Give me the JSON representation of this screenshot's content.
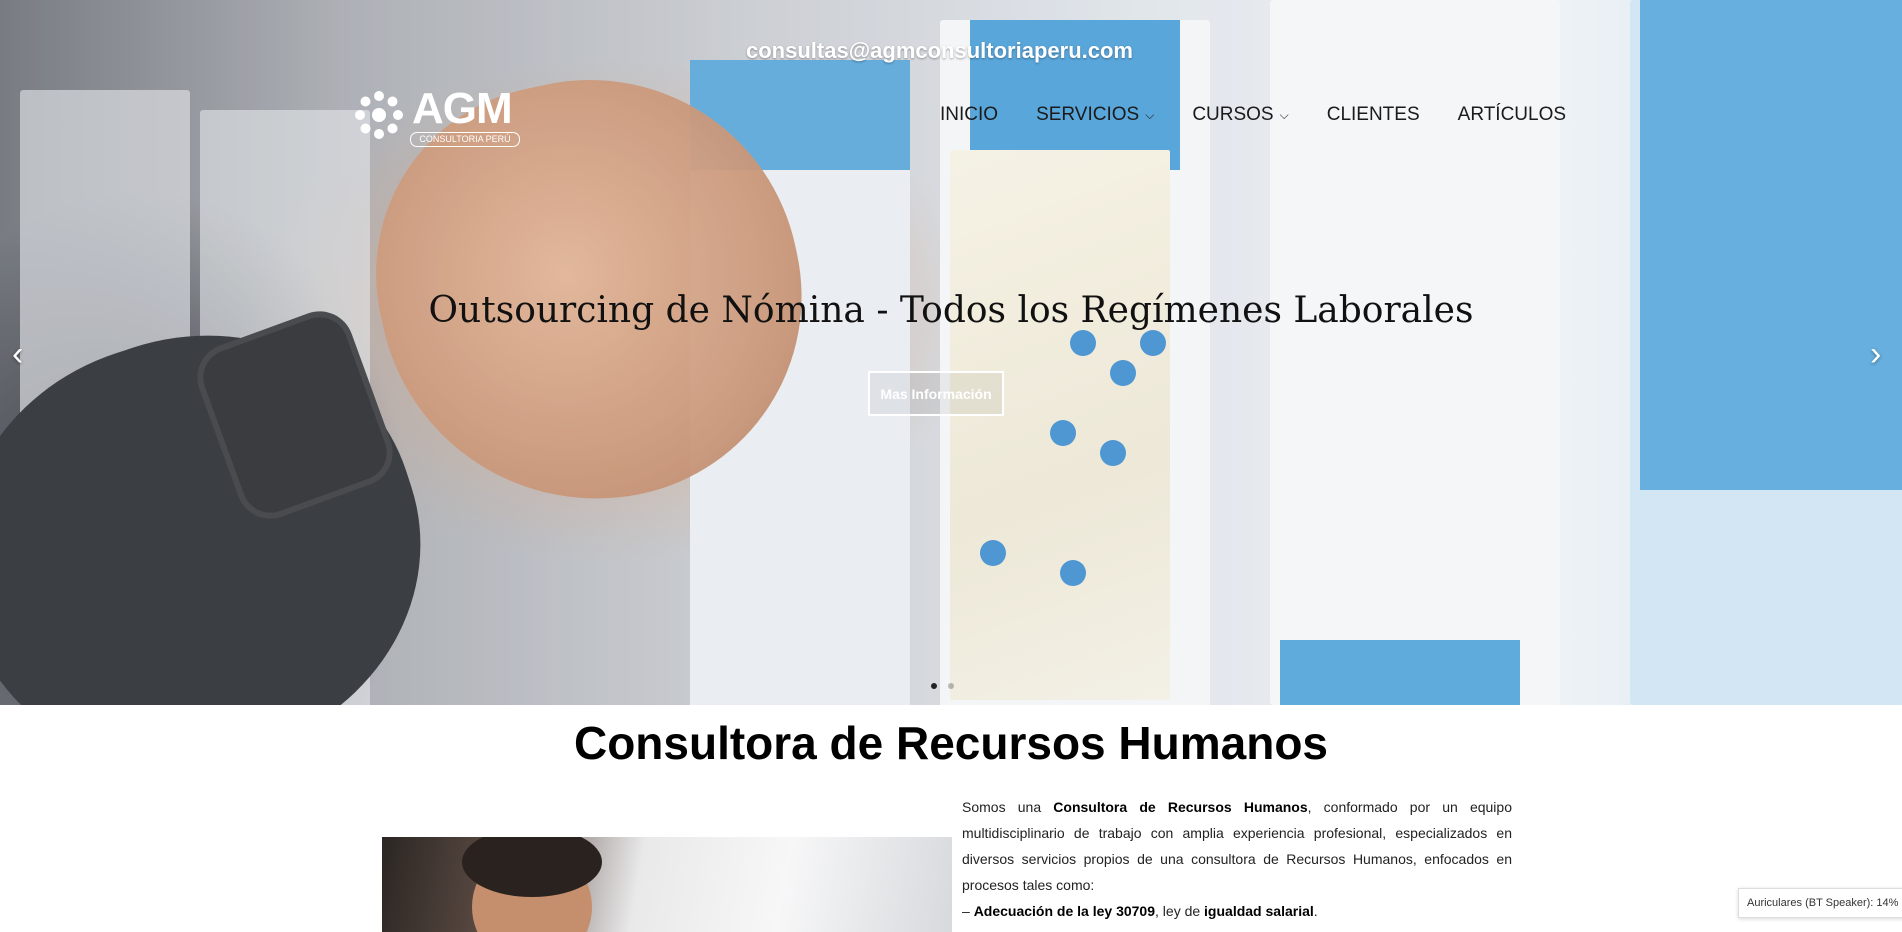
{
  "header": {
    "email": "consultas@agmconsultoriaperu.com",
    "logo": {
      "text": "AGM",
      "subtitle": "CONSULTORIA PERÚ"
    },
    "nav": [
      {
        "label": "INICIO",
        "has_dropdown": false
      },
      {
        "label": "SERVICIOS",
        "has_dropdown": true
      },
      {
        "label": "CURSOS",
        "has_dropdown": true
      },
      {
        "label": "CLIENTES",
        "has_dropdown": false
      },
      {
        "label": "ARTÍCULOS",
        "has_dropdown": false
      }
    ],
    "dropdown_icon": "chevron-down-icon"
  },
  "hero": {
    "title": "Outsourcing de Nómina - Todos los Regímenes Laborales",
    "button_label": "Mas Información",
    "prev_icon": "‹",
    "next_icon": "›",
    "slides_count": 2,
    "active_slide": 1
  },
  "intro": {
    "title": "Consultora de Recursos Humanos",
    "paragraph": {
      "prefix": "Somos una ",
      "bold": "Consultora de Recursos Humanos",
      "suffix": ", conformado por un equipo multidisciplinario de trabajo con amplia experiencia profesional, especializados en diversos servicios propios de una consultora de Recursos Humanos, enfocados en procesos tales como:"
    },
    "bullet": {
      "dash": "– ",
      "bold1": "Adecuación de la ley 30709",
      "mid": ", ley de ",
      "bold2": "igualdad salarial",
      "end": "."
    }
  },
  "system": {
    "toast": "Auriculares (BT Speaker): 14%"
  }
}
